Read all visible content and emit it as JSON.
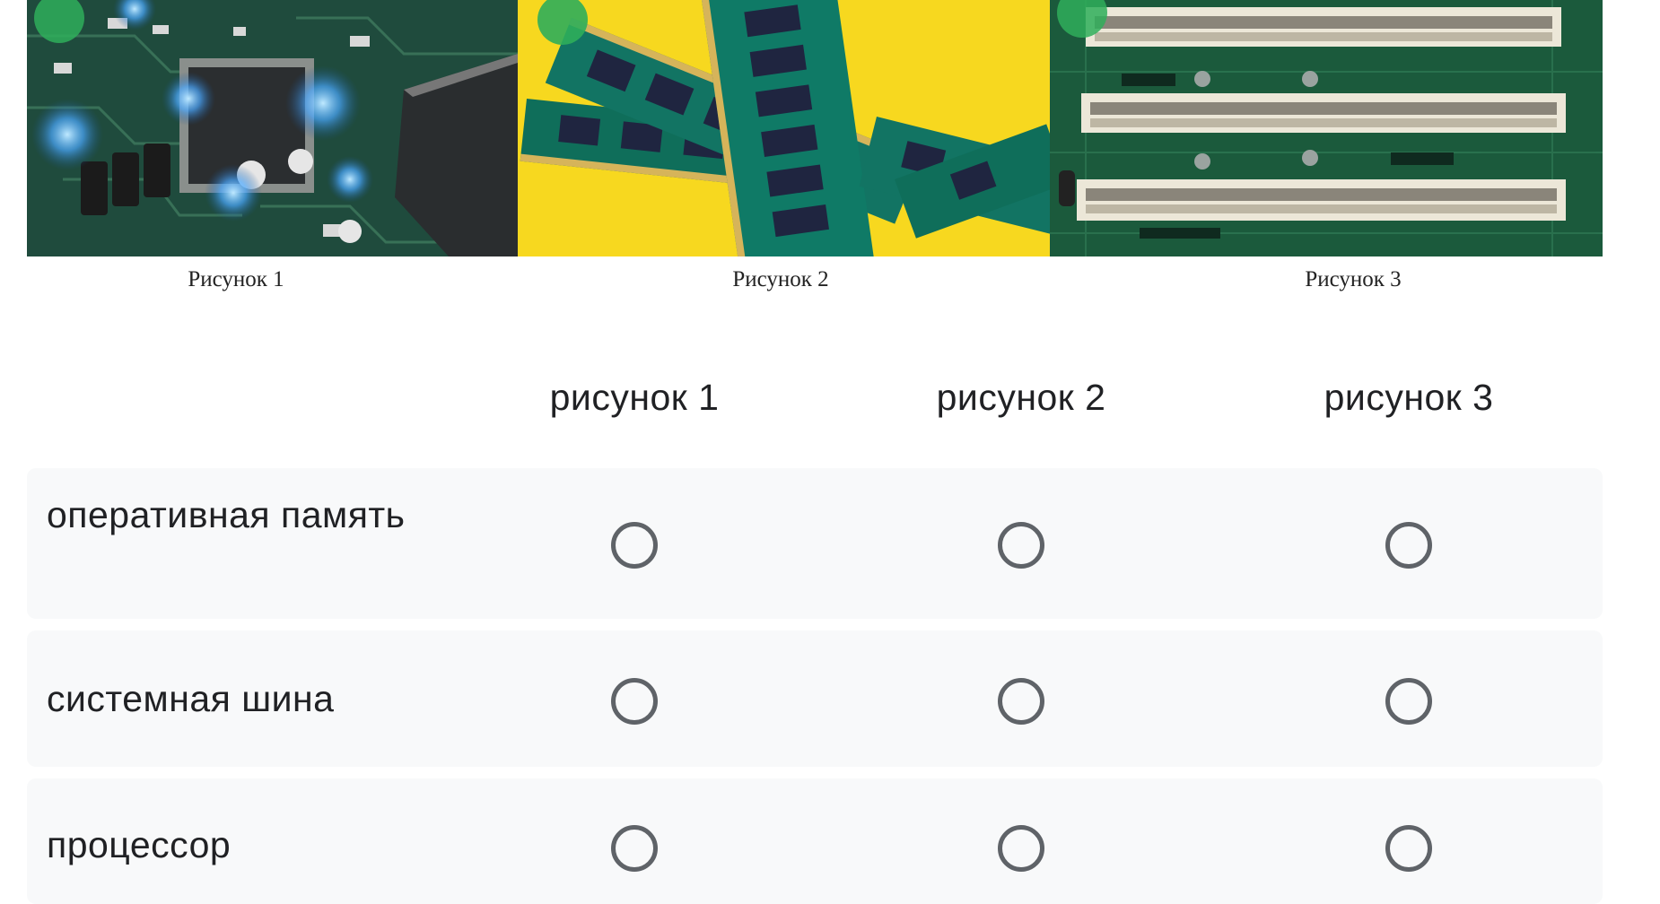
{
  "images": {
    "captions": [
      "Рисунок 1",
      "Рисунок 2",
      "Рисунок 3"
    ]
  },
  "grid": {
    "columns": [
      "рисунок 1",
      "рисунок 2",
      "рисунок 3"
    ],
    "rows": [
      {
        "label": "оперативная память",
        "selected": null
      },
      {
        "label": "системная шина",
        "selected": null
      },
      {
        "label": "процессор",
        "selected": null
      }
    ]
  },
  "colors": {
    "row_background": "#f8f9fa",
    "radio_border": "#5f6368",
    "text": "#202124",
    "photo2_background": "#f7d81f",
    "pcb_green": "#0f5a3a"
  }
}
